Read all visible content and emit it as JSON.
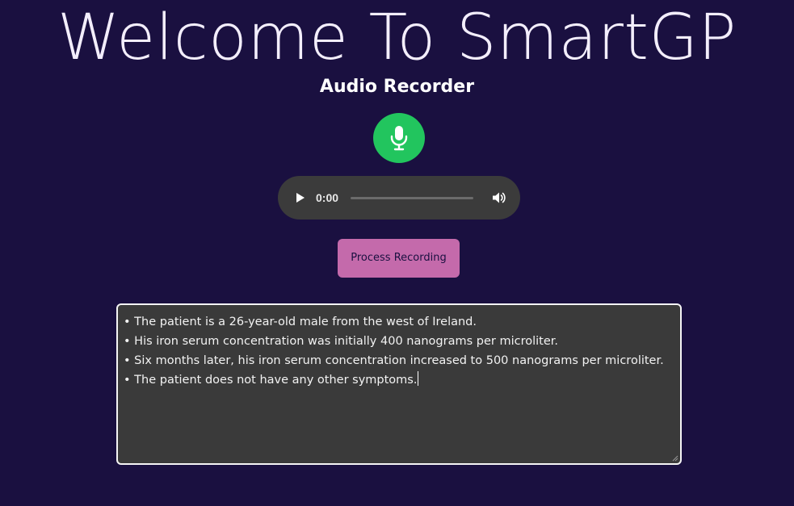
{
  "header": {
    "title": "Welcome To SmartGP",
    "subtitle": "Audio Recorder"
  },
  "recorder": {
    "mic_icon": "microphone-icon",
    "mic_color": "#22c55e"
  },
  "audio_player": {
    "play_icon": "play-icon",
    "time": "0:00",
    "progress": 0,
    "volume_icon": "volume-icon"
  },
  "actions": {
    "process_label": "Process Recording",
    "process_color": "#c46aab"
  },
  "transcript": {
    "lines": [
      "• The patient is a 26-year-old male from the west of Ireland.",
      "• His iron serum concentration was initially 400 nanograms per microliter.",
      "• Six months later, his iron serum concentration increased to 500 nanograms per microliter.",
      "• The patient does not have any other symptoms."
    ]
  },
  "colors": {
    "background": "#1a1040",
    "panel": "#3a3a3a",
    "player": "#3b3b3b"
  }
}
